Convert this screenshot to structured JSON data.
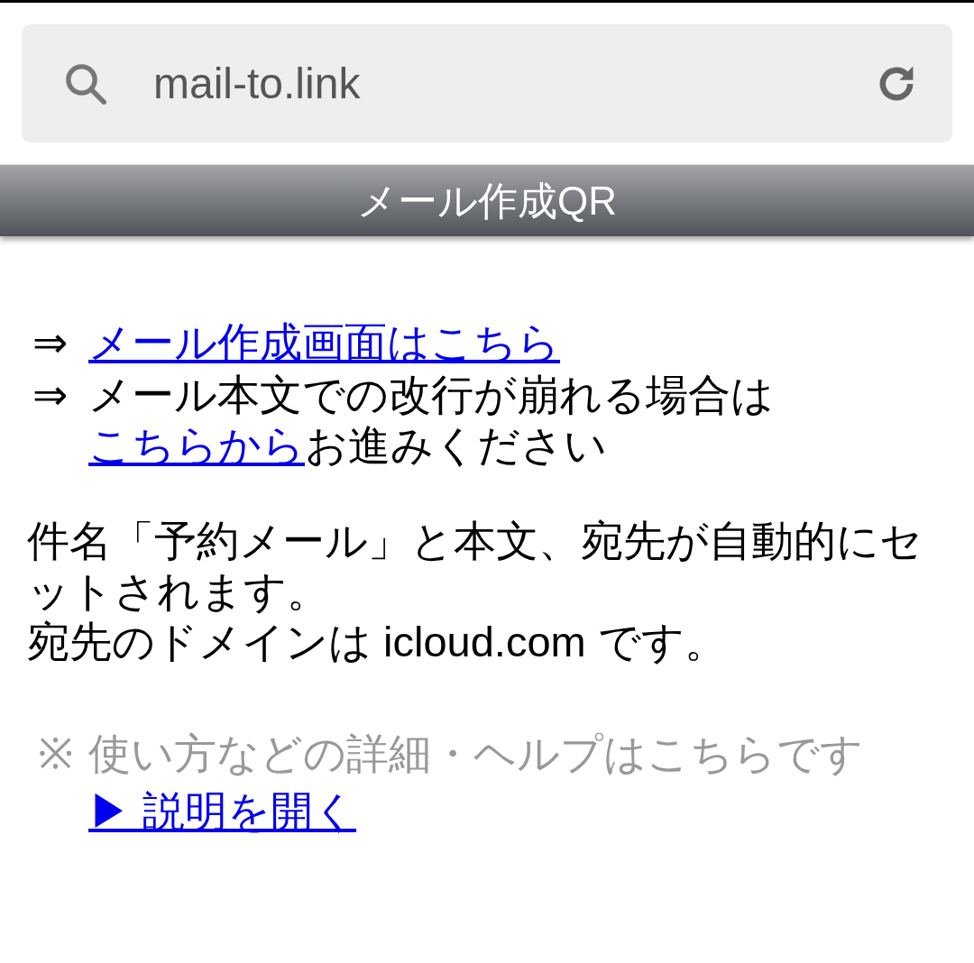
{
  "address_bar": {
    "url": "mail-to.link"
  },
  "header": {
    "title": "メール作成QR"
  },
  "notices": [
    {
      "arrow": "⇒",
      "parts": [
        {
          "kind": "link",
          "text": "メール作成画面はこちら"
        }
      ]
    },
    {
      "arrow": "⇒",
      "parts": [
        {
          "kind": "text",
          "text": "メール本文での改行が崩れる場合は"
        },
        {
          "kind": "link",
          "text": "こちらから"
        },
        {
          "kind": "text",
          "text": "お進みください"
        }
      ]
    }
  ],
  "description": [
    "件名「予約メール」と本文、宛先が自動的にセットされます。",
    "宛先のドメインは icloud.com です。"
  ],
  "help": {
    "mark": "※",
    "text": "使い方などの詳細・ヘルプはこちらです",
    "link": "▶ 説明を開く"
  }
}
